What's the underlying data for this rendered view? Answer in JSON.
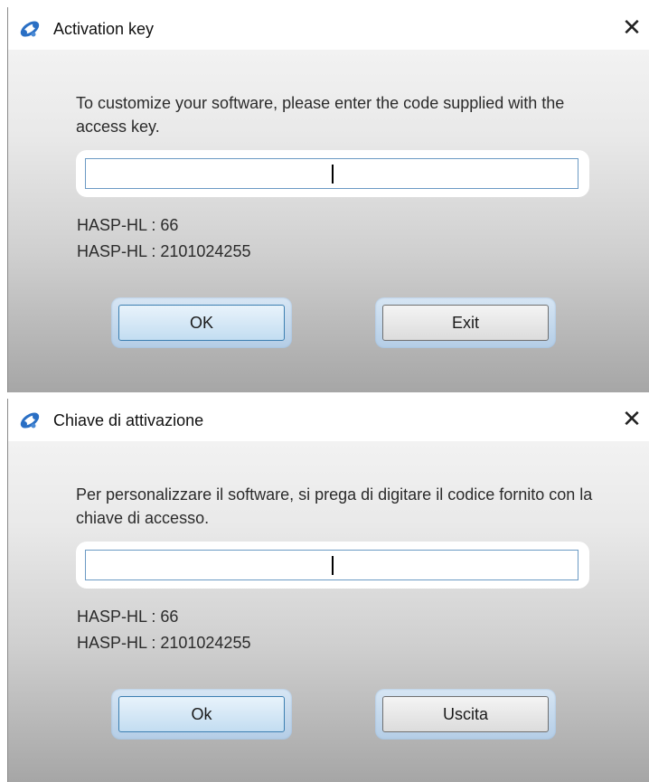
{
  "dialogs": [
    {
      "title": "Activation key",
      "app_icon": "network-link-icon",
      "close_glyph": "✕",
      "prompt": "To customize your software, please enter the code supplied with the access key.",
      "input_value": "",
      "hasp_lines": [
        "HASP-HL : 66",
        "HASP-HL : 2101024255"
      ],
      "ok_label": "OK",
      "exit_label": "Exit"
    },
    {
      "title": "Chiave di attivazione",
      "app_icon": "network-link-icon",
      "close_glyph": "✕",
      "prompt": "Per personalizzare il software, si prega di digitare il codice fornito con la chiave di accesso.",
      "input_value": "",
      "hasp_lines": [
        "HASP-HL : 66",
        "HASP-HL : 2101024255"
      ],
      "ok_label": "Ok",
      "exit_label": "Uscita"
    }
  ],
  "colors": {
    "accent_border": "#3c7fb1",
    "input_border": "#6b9ac4",
    "icon_blue": "#2a6fc4"
  }
}
